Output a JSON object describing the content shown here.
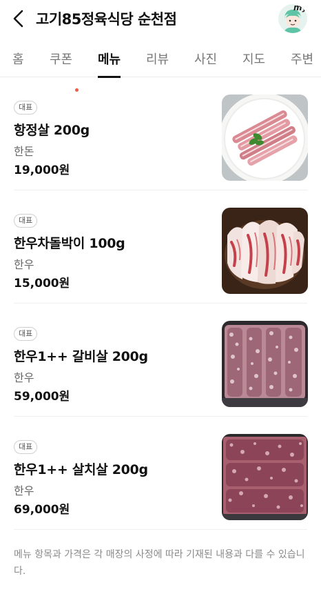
{
  "header": {
    "title": "고기85정육식당 순천점",
    "back_icon": "chevron-left-icon",
    "avatar_text": "my"
  },
  "tabs": [
    {
      "label": "홈",
      "active": false
    },
    {
      "label": "쿠폰",
      "active": false,
      "new_dot": true
    },
    {
      "label": "메뉴",
      "active": true
    },
    {
      "label": "리뷰",
      "active": false
    },
    {
      "label": "사진",
      "active": false
    },
    {
      "label": "지도",
      "active": false
    },
    {
      "label": "주변",
      "active": false
    }
  ],
  "menu": {
    "items": [
      {
        "badge": "대표",
        "name": "항정살 200g",
        "sub": "한돈",
        "price": "19,000원"
      },
      {
        "badge": "대표",
        "name": "한우차돌박이 100g",
        "sub": "한우",
        "price": "15,000원"
      },
      {
        "badge": "대표",
        "name": "한우1++ 갈비살 200g",
        "sub": "한우",
        "price": "59,000원"
      },
      {
        "badge": "대표",
        "name": "한우1++ 살치살 200g",
        "sub": "한우",
        "price": "69,000원"
      }
    ]
  },
  "notice": "메뉴 항목과 가격은 각 매장의 사정에 따라 기재된 내용과 다를 수 있습니다.",
  "colors": {
    "accent": "#111111",
    "new_dot": "#f05c45",
    "muted": "#8a8a8a"
  }
}
